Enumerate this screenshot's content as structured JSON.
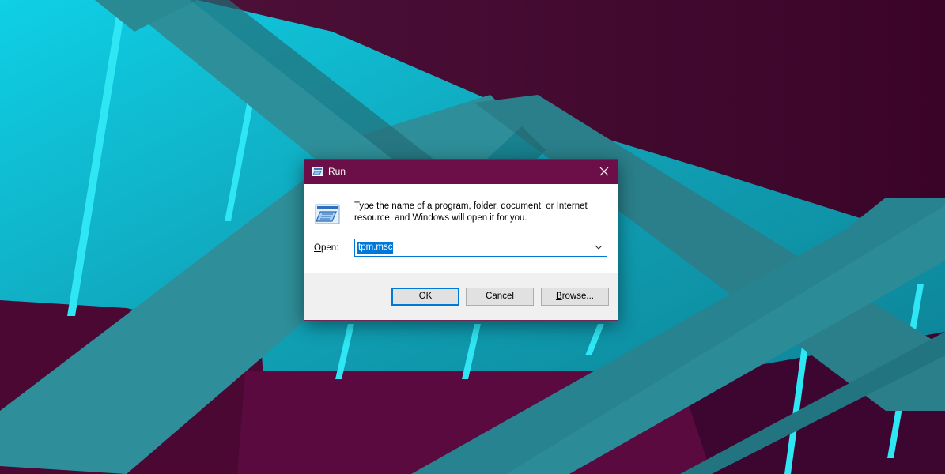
{
  "dialog": {
    "title": "Run",
    "description": "Type the name of a program, folder, document, or Internet resource, and Windows will open it for you.",
    "open_label_accel": "O",
    "open_label_rest": "pen:",
    "open_value": "tpm.msc",
    "ok_label": "OK",
    "cancel_label": "Cancel",
    "browse_label_accel": "B",
    "browse_label_rest": "rowse..."
  },
  "colors": {
    "title_bar": "#6c0e47",
    "accent": "#0078d7"
  },
  "icons": {
    "title": "run-icon",
    "content": "run-icon",
    "close": "close-icon",
    "dropdown": "chevron-down-icon"
  }
}
